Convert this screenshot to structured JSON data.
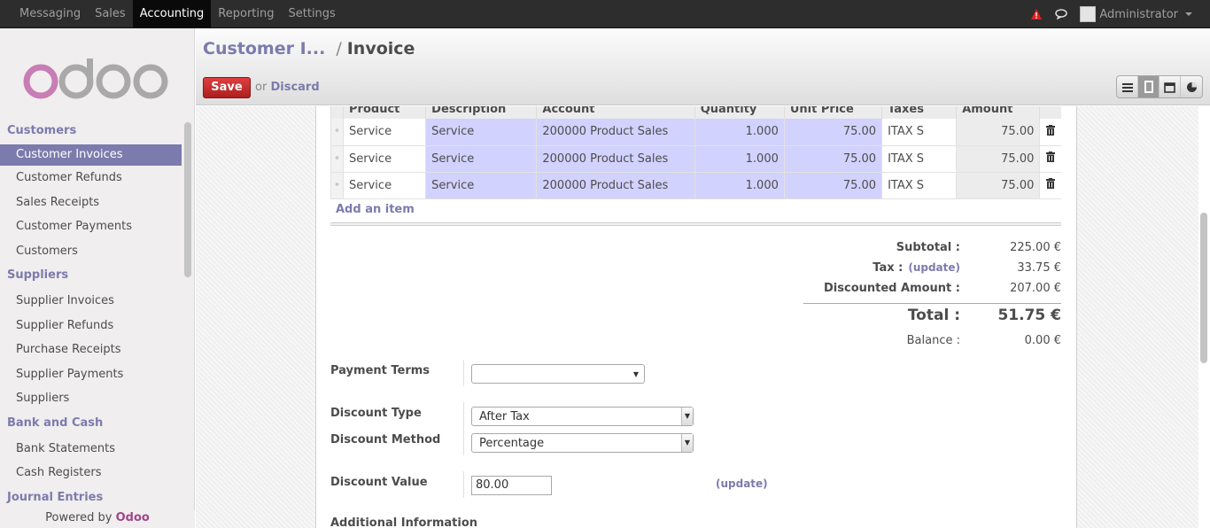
{
  "topbar": {
    "menu": [
      "Messaging",
      "Sales",
      "Accounting",
      "Reporting",
      "Settings"
    ],
    "user": "Administrator"
  },
  "sidebar": {
    "sections": [
      {
        "title": "Customers",
        "items": [
          "Customer Invoices",
          "Customer Refunds",
          "Sales Receipts",
          "Customer Payments",
          "Customers"
        ]
      },
      {
        "title": "Suppliers",
        "items": [
          "Supplier Invoices",
          "Supplier Refunds",
          "Purchase Receipts",
          "Supplier Payments",
          "Suppliers"
        ]
      },
      {
        "title": "Bank and Cash",
        "items": [
          "Bank Statements",
          "Cash Registers"
        ]
      },
      {
        "title": "Journal Entries",
        "items": []
      }
    ],
    "powered_prefix": "Powered by",
    "powered_brand": "Odoo"
  },
  "header": {
    "crumb": "Customer I...",
    "separator": "/",
    "current": "Invoice",
    "save_label": "Save",
    "or_label": "or",
    "discard_label": "Discard"
  },
  "table": {
    "columns": [
      "Product",
      "Description",
      "Account",
      "Quantity",
      "Unit Price",
      "Taxes",
      "Amount"
    ],
    "rows": [
      [
        "Service",
        "Service",
        "200000 Product Sales",
        "1.000",
        "75.00",
        "ITAX S",
        "75.00"
      ],
      [
        "Service",
        "Service",
        "200000 Product Sales",
        "1.000",
        "75.00",
        "ITAX S",
        "75.00"
      ],
      [
        "Service",
        "Service",
        "200000 Product Sales",
        "1.000",
        "75.00",
        "ITAX S",
        "75.00"
      ]
    ],
    "add_item": "Add an item"
  },
  "totals": {
    "subtotal_label": "Subtotal :",
    "subtotal": "225.00 €",
    "tax_label": "Tax :",
    "tax_update": "(update)",
    "tax": "33.75 €",
    "discounted_label": "Discounted Amount :",
    "discounted": "207.00 €",
    "total_label": "Total :",
    "total": "51.75 €",
    "balance_label": "Balance :",
    "balance": "0.00 €"
  },
  "form": {
    "payment_terms_label": "Payment Terms",
    "payment_terms_value": "",
    "discount_type_label": "Discount Type",
    "discount_type_value": "After Tax",
    "discount_method_label": "Discount Method",
    "discount_method_value": "Percentage",
    "discount_value_label": "Discount Value",
    "discount_value": "80.00",
    "update_label": "(update)",
    "additional_info": "Additional Information"
  }
}
